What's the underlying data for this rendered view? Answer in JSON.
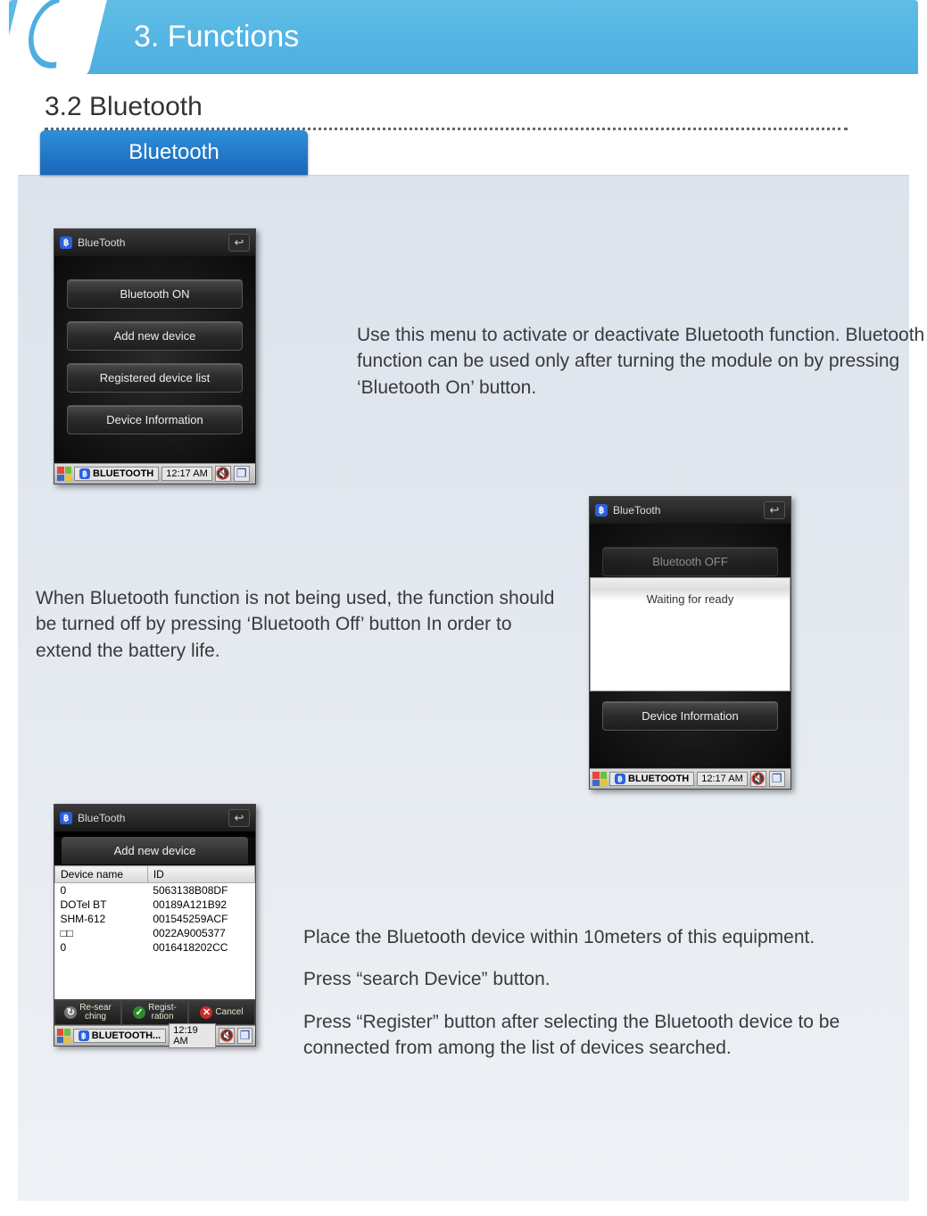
{
  "header": {
    "title": "3. Functions"
  },
  "section": {
    "title": "3.2 Bluetooth",
    "tab_label": "Bluetooth"
  },
  "phone_common": {
    "title": "BlueTooth",
    "taskbar_app": "BLUETOOTH",
    "taskbar_app_lower": "BLUETOOTH..."
  },
  "phone1": {
    "buttons": [
      "Bluetooth ON",
      "Add new device",
      "Registered device list",
      "Device Information"
    ],
    "time": "12:17 AM"
  },
  "phone2": {
    "partial_top_button": "Bluetooth OFF",
    "dialog_text": "Waiting for ready",
    "bottom_button": "Device Information",
    "time": "12:17 AM"
  },
  "phone3": {
    "header": "Add new device",
    "columns": [
      "Device name",
      "ID"
    ],
    "rows": [
      {
        "name": "0",
        "id": "5063138B08DF"
      },
      {
        "name": "DOTel BT",
        "id": "00189A121B92"
      },
      {
        "name": "SHM-612",
        "id": "001545259ACF"
      },
      {
        "name": "□□",
        "id": "0022A9005377"
      },
      {
        "name": "0",
        "id": "0016418202CC"
      }
    ],
    "bottom_buttons": {
      "research": "Re-sear\nching",
      "register": "Regist-\nration",
      "cancel": "Cancel"
    },
    "time": "12:19 AM"
  },
  "paragraph1": "Use this menu to activate or deactivate Bluetooth function. Bluetooth function can be used only after turning the module on by pressing ‘Bluetooth On’ button.",
  "paragraph2": "When Bluetooth function is not being used, the function should be turned off by pressing ‘Bluetooth Off’ button In order to extend the battery life.",
  "paragraph3": {
    "p1": "Place the Bluetooth device within 10meters of this equipment.",
    "p2": "Press “search Device” button.",
    "p3": "Press “Register” button after selecting the Bluetooth device to be connected from among the list of devices searched."
  }
}
